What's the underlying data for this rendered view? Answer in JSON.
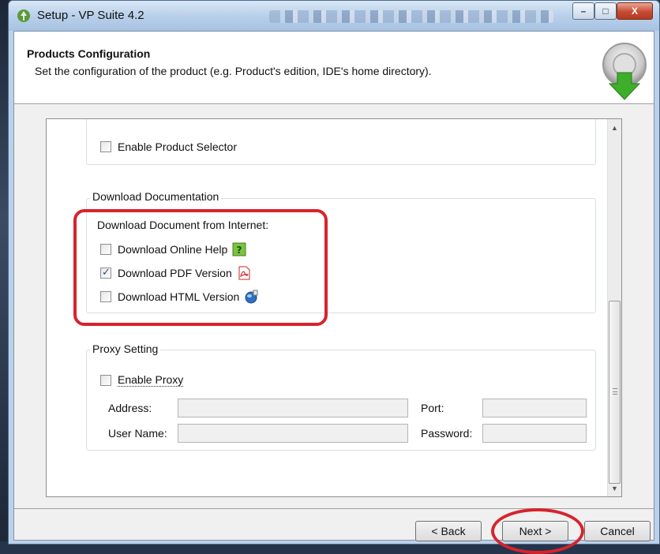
{
  "window": {
    "title": "Setup - VP Suite 4.2",
    "controls": {
      "minimize": "–",
      "maximize": "□",
      "close": "X"
    }
  },
  "header": {
    "title": "Products Configuration",
    "subtitle": "Set the configuration of the product (e.g. Product's edition, IDE's home directory)."
  },
  "product_selector": {
    "checkbox_label": "Enable Product Selector",
    "checked": false
  },
  "download_documentation": {
    "group_label": "Download Documentation",
    "subheading": "Download Document from Internet:",
    "options": [
      {
        "label": "Download Online Help",
        "checked": false,
        "icon": "help-book-icon"
      },
      {
        "label": "Download PDF Version",
        "checked": true,
        "icon": "pdf-icon"
      },
      {
        "label": "Download HTML Version",
        "checked": false,
        "icon": "globe-icon"
      }
    ]
  },
  "proxy": {
    "group_label": "Proxy Setting",
    "enable_label": "Enable Proxy",
    "enabled": false,
    "address_label": "Address:",
    "address_value": "",
    "port_label": "Port:",
    "port_value": "",
    "username_label": "User Name:",
    "username_value": "",
    "password_label": "Password:",
    "password_value": ""
  },
  "buttons": {
    "back": "< Back",
    "next": "Next >",
    "cancel": "Cancel"
  },
  "colors": {
    "highlight": "#d8232c",
    "titlebar": "#b9d0ea",
    "dialog_bg": "#f0f0f0"
  }
}
